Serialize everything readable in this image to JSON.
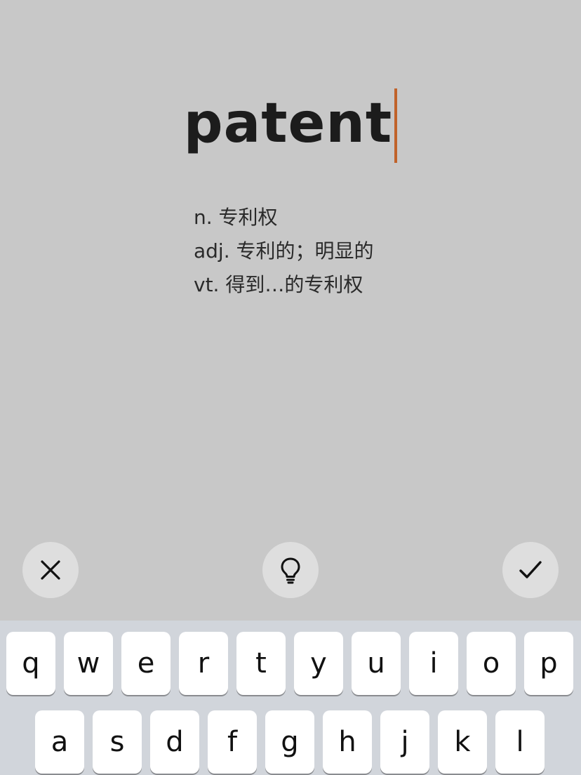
{
  "word": {
    "text": "patent",
    "caret_color": "#c0622a"
  },
  "definitions": [
    "n. 专利权",
    "adj. 专利的；明显的",
    "vt. 得到…的专利权"
  ],
  "actions": {
    "dismiss_icon": "close-icon",
    "hint_icon": "lightbulb-icon",
    "confirm_icon": "checkmark-icon"
  },
  "keyboard": {
    "row1": [
      "q",
      "w",
      "e",
      "r",
      "t",
      "y",
      "u",
      "i",
      "o",
      "p"
    ],
    "row2": [
      "a",
      "s",
      "d",
      "f",
      "g",
      "h",
      "j",
      "k",
      "l"
    ]
  }
}
